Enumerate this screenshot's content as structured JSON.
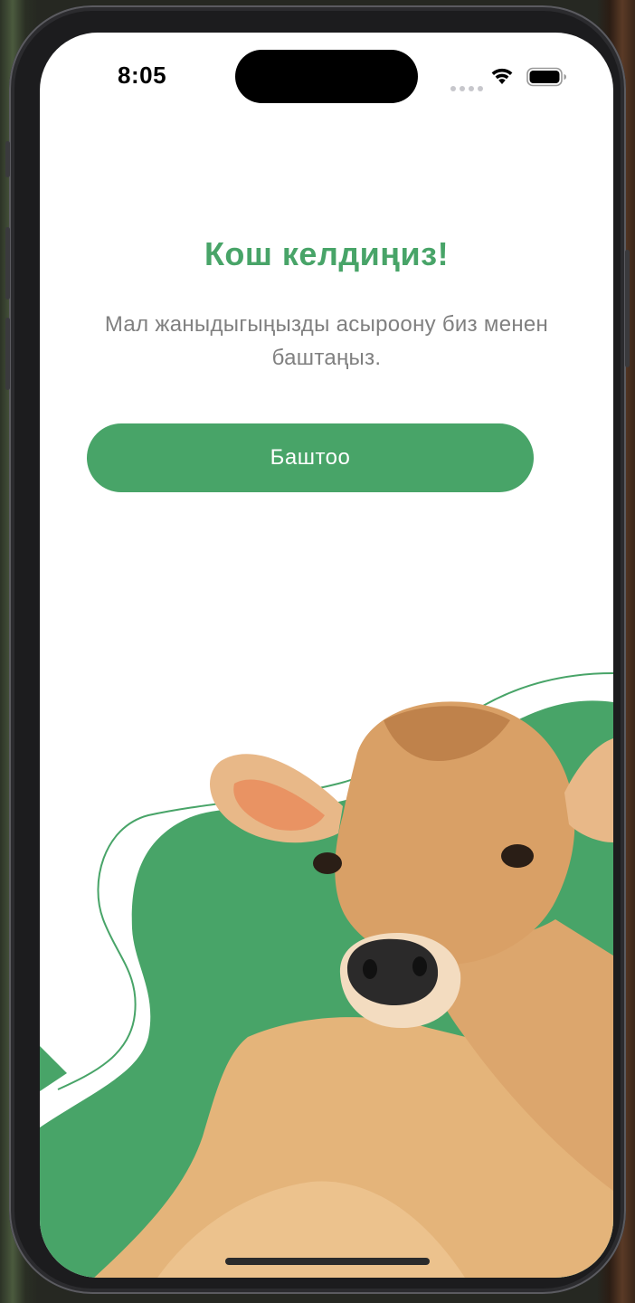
{
  "status_bar": {
    "time": "8:05"
  },
  "welcome": {
    "title": "Кош келдиңиз!",
    "subtitle": "Мал жаныдыгыңызды асыроону биз менен баштаңыз.",
    "start_button": "Баштоо"
  },
  "illustration": {
    "subject": "calf",
    "accent_color": "#48a468"
  },
  "colors": {
    "accent": "#48a468",
    "subtitle": "#808080",
    "background": "#ffffff"
  }
}
